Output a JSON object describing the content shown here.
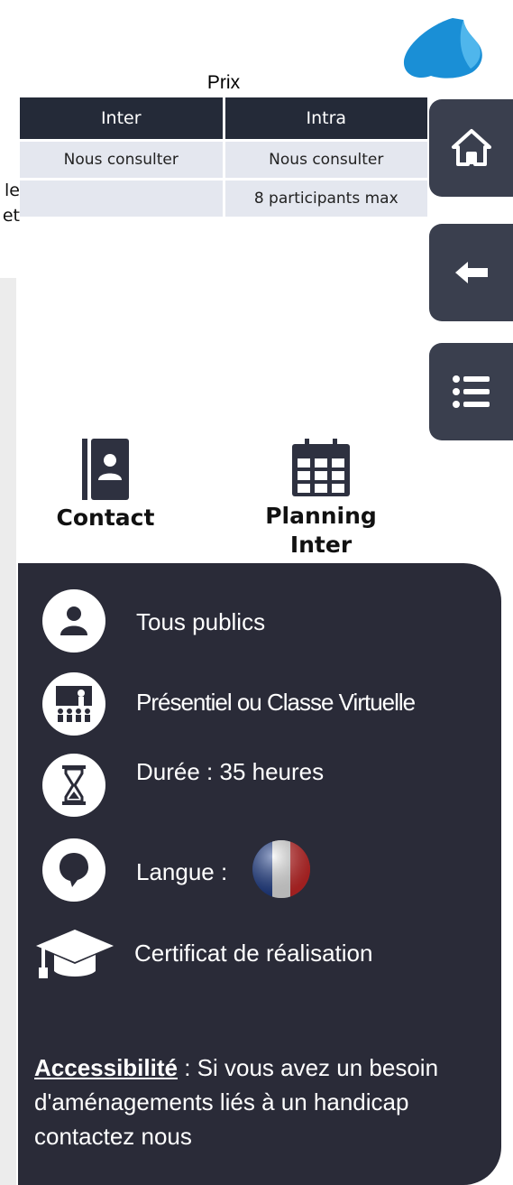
{
  "prix": {
    "title": "Prix",
    "headers": [
      "Inter",
      "Intra"
    ],
    "rows": [
      [
        "Nous consulter",
        "Nous consulter"
      ],
      [
        "",
        "8 participants max"
      ]
    ]
  },
  "clipped_text": {
    "line1": "le",
    "line2": "et"
  },
  "nav": {
    "home_icon": "home-icon",
    "back_icon": "arrow-left-icon",
    "menu_icon": "list-icon"
  },
  "quick_links": {
    "contact": "Contact",
    "planning": "Planning Inter"
  },
  "info": {
    "public": "Tous publics",
    "modalite": "Présentiel ou Classe Virtuelle",
    "duree": "Durée : 35 heures",
    "langue": "Langue :",
    "certificat": "Certificat de réalisation",
    "access_label": "Accessibilité",
    "access_text": " : Si vous avez un besoin d'aménagements liés à un handicap contactez nous"
  },
  "colors": {
    "dark_panel": "#2a2b38",
    "nav_button": "#3a3f4e",
    "table_header": "#242a38",
    "table_cell": "#e4e7ef",
    "logo_blue": "#1a8fd6"
  }
}
